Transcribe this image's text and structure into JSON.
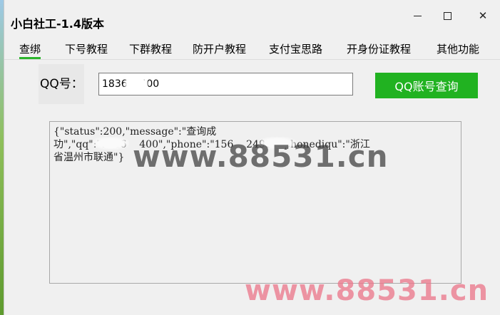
{
  "window": {
    "title": "小白社工-1.4版本",
    "minimize_icon": "minimize-icon",
    "maximize_icon": "maximize-icon",
    "close_glyph": "✕"
  },
  "tabs": [
    {
      "label": "查绑",
      "active": true
    },
    {
      "label": "下号教程",
      "active": false
    },
    {
      "label": "下群教程",
      "active": false
    },
    {
      "label": "防开户教程",
      "active": false
    },
    {
      "label": "支付宝思路",
      "active": false
    },
    {
      "label": "开身份证教程",
      "active": false
    },
    {
      "label": "其他功能",
      "active": false
    }
  ],
  "query": {
    "label": "QQ号：",
    "input_value": "1836    400",
    "button_label": "QQ账号查询"
  },
  "result": {
    "lines": [
      "{\"status\":200,\"message\":\"查询成",
      "功\",\"qq\":\"1836    400\",\"phone\":\"156    2490\",\"phonediqu\":\"浙江",
      "省温州市联通\"}"
    ]
  },
  "watermarks": {
    "center": "www.88531.cn",
    "bottom_right": "www.88531.cn"
  },
  "colors": {
    "accent_green": "#21b221",
    "tab_underline": "#2cb42c",
    "watermark_pink": "#eb788c"
  }
}
